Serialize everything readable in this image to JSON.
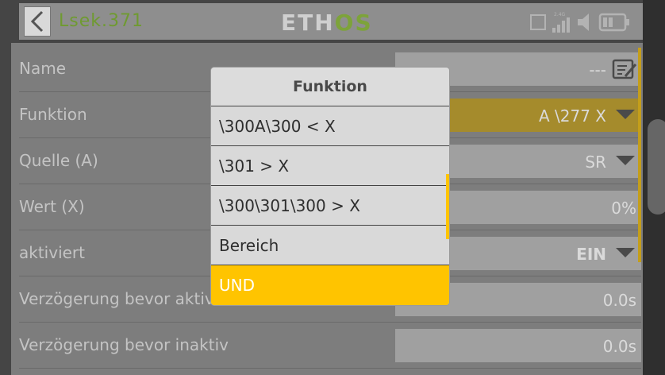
{
  "header": {
    "model_name": "Lsek.371",
    "logo_left": "ETH",
    "logo_right": "OS",
    "status_icons": [
      "receiver-square-icon",
      "signal-bars-icon",
      "speaker-icon",
      "battery-icon"
    ],
    "signal_band": "2.4G"
  },
  "rows": [
    {
      "label": "Name",
      "value": "---"
    },
    {
      "label": "Funktion",
      "value": "A \\277 X"
    },
    {
      "label": "Quelle (A)",
      "value": "SR"
    },
    {
      "label": "Wert (X)",
      "value": "0%"
    },
    {
      "label": "aktiviert",
      "value": "EIN"
    },
    {
      "label": "Verzögerung bevor aktiv",
      "value": "0.0s"
    },
    {
      "label": "Verzögerung bevor inaktiv",
      "value": "0.0s"
    }
  ],
  "popup": {
    "title": "Funktion",
    "options": [
      "\\300A\\300 < X",
      "\\301 > X",
      "\\300\\301\\300 > X",
      "Bereich",
      "UND"
    ],
    "selected_index": 4
  },
  "colors": {
    "accent": "#ffc400",
    "logo_green": "#7da33a",
    "model_name_green": "#6f9a31"
  }
}
